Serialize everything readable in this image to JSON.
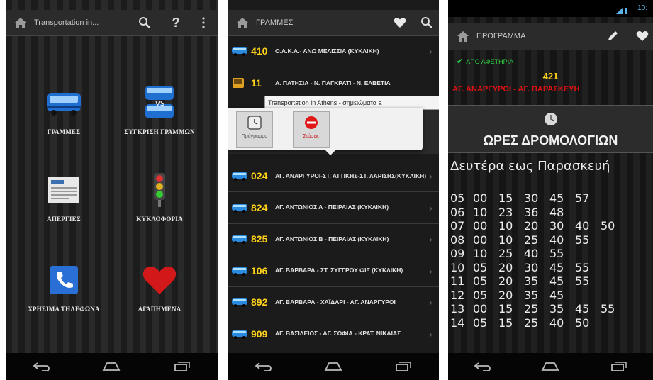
{
  "screen1": {
    "title": "Transportation in...",
    "tiles": [
      {
        "label": "ΓΡΑΜΜΕΣ"
      },
      {
        "label": "ΣΥΓΚΡΙΣΗ ΓΡΑΜΜΩΝ"
      },
      {
        "label": "ΑΠΕΡΓΙΕΣ"
      },
      {
        "label": "ΚΥΚΛΟΦΟΡΙΑ"
      },
      {
        "label": "ΧΡΗΣΙΜΑ ΤΗΛΕΦΩΝΑ"
      },
      {
        "label": "ΑΓΑΠΗΜΕΝΑ"
      }
    ]
  },
  "screen2": {
    "title": "ΓΡΑΜΜΕΣ",
    "routes_top": [
      {
        "num": "410",
        "name": "Ο.Α.Κ.Α.- ΑΝΩ ΜΕΛΙΣΣΙΑ (ΚΥΚΛΙΚΗ)"
      },
      {
        "num": "11",
        "name": "Α. ΠΑΤΗΣΙΑ - Ν. ΠΑΓΚΡΑΤΙ - Ν. ΕΛΒΕΤΙΑ"
      }
    ],
    "tooltip": "Transportation in Athens - σημειώματα a",
    "popup": {
      "schedule_label": "Πρόγραμμα",
      "stops_label": "Στάσεις"
    },
    "routes": [
      {
        "num": "024",
        "name": "ΑΓ. ΑΝΑΡΓΥΡΟΙ-ΣΤ. ΑΤΤΙΚΗΣ-ΣΤ. ΛΑΡΙΣΗΣ(ΚΥΚΛΙΚΗ)"
      },
      {
        "num": "824",
        "name": "ΑΓ. ΑΝΤΩΝΙΟΣ Α - ΠΕΙΡΑΙΑΣ (ΚΥΚΛΙΚΗ)"
      },
      {
        "num": "825",
        "name": "ΑΓ. ΑΝΤΩΝΙΟΣ Β - ΠΕΙΡΑΙΑΣ (ΚΥΚΛΙΚΗ)"
      },
      {
        "num": "106",
        "name": "ΑΓ. ΒΑΡΒΑΡΑ - ΣΤ. ΣΥΓΓΡΟΥ ΦΙΞ (ΚΥΚΛΙΚΗ)"
      },
      {
        "num": "892",
        "name": "ΑΓ. ΒΑΡΒΑΡΑ - ΧΑΪΔΑΡΙ - ΑΓ. ΑΝΑΡΓΥΡΟΙ"
      },
      {
        "num": "909",
        "name": "ΑΓ. ΒΑΣΙΛΕΙΟΣ - ΑΓ. ΣΟΦΙΑ - ΚΡΑΤ. ΝΙΚΑΙΑΣ"
      }
    ]
  },
  "screen3": {
    "status_time": "10:",
    "title": "ΠΡΟΓΡΑΜΜΑ",
    "direction": "ΑΠΟ ΑΦΕΤΗΡΙΑ",
    "route_num": "421",
    "route_name": "ΑΓ. ΑΝΑΡΓΥΡΟΙ - ΑΓ. ΠΑΡΑΣΚΕΥΗ",
    "schedule_heading": "ΩΡΕΣ ΔΡΟΜΟΛΟΓΙΩΝ",
    "day_label": "Δευτέρα εως Παρασκευή",
    "times": [
      {
        "hour": "05",
        "mins": [
          "00",
          "15",
          "30",
          "45",
          "57"
        ]
      },
      {
        "hour": "06",
        "mins": [
          "10",
          "23",
          "36",
          "48"
        ]
      },
      {
        "hour": "07",
        "mins": [
          "00",
          "10",
          "20",
          "30",
          "40",
          "50"
        ]
      },
      {
        "hour": "08",
        "mins": [
          "00",
          "10",
          "25",
          "40",
          "55"
        ]
      },
      {
        "hour": "09",
        "mins": [
          "10",
          "25",
          "40",
          "55"
        ]
      },
      {
        "hour": "10",
        "mins": [
          "05",
          "20",
          "30",
          "45",
          "55"
        ]
      },
      {
        "hour": "11",
        "mins": [
          "05",
          "20",
          "35",
          "45",
          "55"
        ]
      },
      {
        "hour": "12",
        "mins": [
          "05",
          "20",
          "35",
          "45"
        ]
      },
      {
        "hour": "13",
        "mins": [
          "00",
          "15",
          "25",
          "35",
          "45",
          "55"
        ]
      },
      {
        "hour": "14",
        "mins": [
          "05",
          "15",
          "25",
          "40",
          "50"
        ]
      }
    ]
  },
  "colors": {
    "accent_yellow": "#ffd21a",
    "route_red": "#e01010",
    "direction_green": "#2ecc40"
  }
}
